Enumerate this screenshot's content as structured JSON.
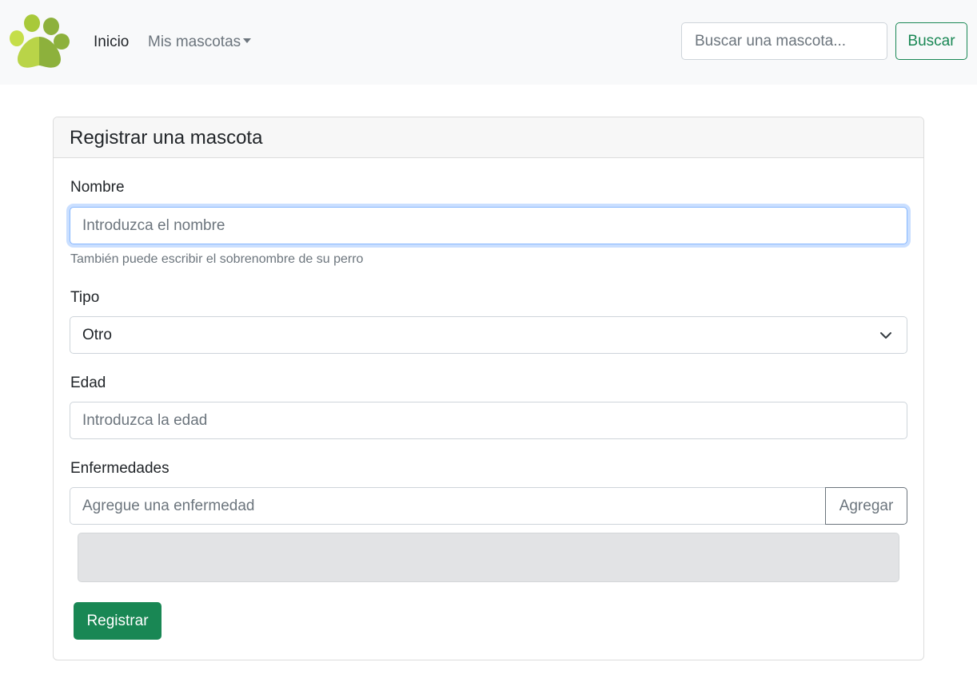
{
  "navbar": {
    "home_label": "Inicio",
    "pets_label": "Mis mascotas",
    "search_placeholder": "Buscar una mascota...",
    "search_button": "Buscar"
  },
  "brand": {
    "logo_icon": "paw-icon",
    "colors": [
      "#a8c93a",
      "#8db13c",
      "#c5de4a"
    ]
  },
  "form": {
    "title": "Registrar una mascota",
    "name_label": "Nombre",
    "name_placeholder": "Introduzca el nombre",
    "name_help": "También puede escribir el sobrenombre de su perro",
    "type_label": "Tipo",
    "type_selected": "Otro",
    "age_label": "Edad",
    "age_placeholder": "Introduzca la edad",
    "diseases_label": "Enfermedades",
    "diseases_placeholder": "Agregue una enfermedad",
    "add_button": "Agregar",
    "submit_button": "Registrar"
  },
  "colors": {
    "primary": "#198754",
    "focus": "#86b7fe",
    "muted": "#6c757d"
  }
}
